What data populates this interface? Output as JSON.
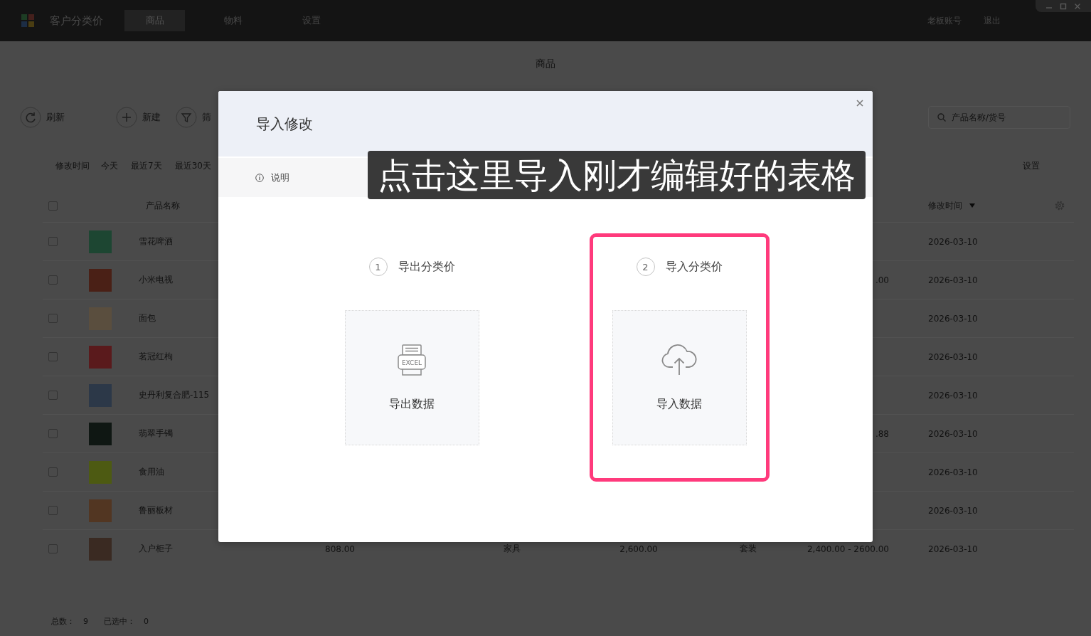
{
  "top_bar": {
    "app_title": "客户分类价",
    "tabs": [
      {
        "label": "商品",
        "selected": true
      },
      {
        "label": "物料",
        "selected": false
      },
      {
        "label": "设置",
        "selected": false
      }
    ],
    "account": "老板账号",
    "logout": "退出"
  },
  "page": {
    "title": "商品"
  },
  "toolbar": {
    "buttons": [
      {
        "kind": "refresh",
        "label": "刷新"
      },
      {
        "kind": "add",
        "label": "新建"
      },
      {
        "kind": "filter",
        "label": "筛"
      }
    ],
    "search": {
      "placeholder": "产品名称/货号"
    }
  },
  "filter_bar": {
    "label": "修改时间",
    "options": [
      {
        "label": "今天",
        "selected": false
      },
      {
        "label": "最近7天",
        "selected": false
      },
      {
        "label": "最近30天",
        "selected": false
      }
    ],
    "settings": "设置"
  },
  "table": {
    "all_checked": false,
    "columns": [
      {
        "label": "产品名称"
      },
      {
        "label": "修改时间"
      }
    ],
    "sort_descending": true,
    "rows": [
      {
        "checked": false,
        "name": "雪花啤酒",
        "modified": "2026-03-10"
      },
      {
        "checked": false,
        "name": "小米电视",
        "column_7": ".00",
        "modified": "2026-03-10"
      },
      {
        "checked": false,
        "name": "面包",
        "modified": "2026-03-10"
      },
      {
        "checked": false,
        "name": "茗冠红枸",
        "modified": "2026-03-10"
      },
      {
        "checked": false,
        "name": "史丹利复合肥-115",
        "modified": "2026-03-10"
      },
      {
        "checked": false,
        "name": "翡翠手镯",
        "column_7": ".88",
        "modified": "2026-03-10"
      },
      {
        "checked": false,
        "name": "食用油",
        "modified": "2026-03-10"
      },
      {
        "checked": false,
        "name": "鲁丽板材",
        "modified": "2026-03-10"
      },
      {
        "checked": false,
        "name": "入户柜子",
        "column_3": "808.00",
        "column_4": "家具",
        "column_5": "2,600.00",
        "column_6": "套装",
        "column_7": "2,400.00 - 2600.00",
        "modified": "2026-03-10"
      }
    ]
  },
  "footer": {
    "total_label": "总数：",
    "total": "9",
    "selected_label": "已选中：",
    "selected_count": "0"
  },
  "dialog": {
    "title": "导入修改",
    "tabs": [
      {
        "label": "说明"
      }
    ],
    "steps": [
      {
        "kind": "export",
        "number": "1",
        "title": "导出分类价",
        "icon_text": "EXCEL",
        "action": "导出数据",
        "highlighted": false
      },
      {
        "kind": "import",
        "number": "2",
        "title": "导入分类价",
        "action": "导入数据",
        "highlighted": true
      }
    ]
  },
  "annotation": {
    "text": "点击这里导入刚才编辑好的表格"
  }
}
